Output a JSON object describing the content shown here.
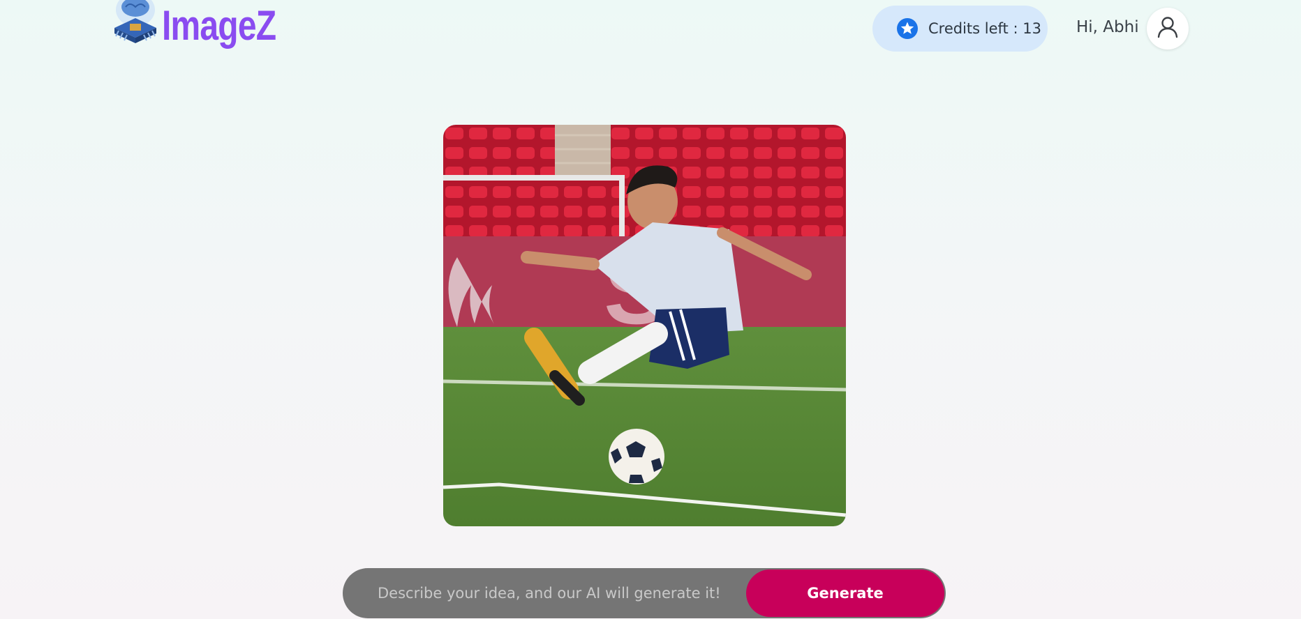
{
  "brand": {
    "name": "ImageZ",
    "logo_icon": "brain-chip-icon",
    "color": "#8a4cf0"
  },
  "header": {
    "credits_label": "Credits left : 13",
    "credits_icon": "star-badge-icon",
    "greeting": "Hi, Abhi",
    "avatar_icon": "user-icon"
  },
  "preview": {
    "subject_icon": "generated-image"
  },
  "prompt": {
    "placeholder": "Describe your idea, and our AI will generate it!",
    "value": "",
    "button_label": "Generate",
    "button_color": "#c8005a"
  }
}
